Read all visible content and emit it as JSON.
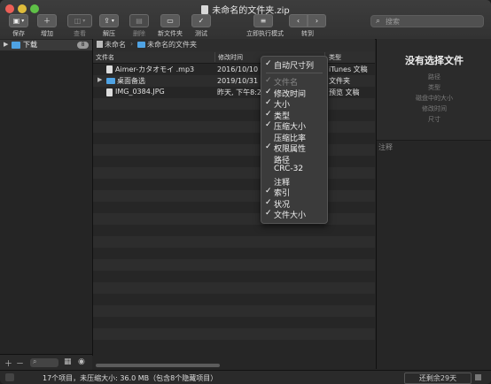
{
  "window": {
    "title": "未命名的文件夹.zip"
  },
  "toolbar": {
    "save": "保存",
    "add": "增加",
    "view": "查看",
    "extract": "解压",
    "delete": "删除",
    "new_folder": "新文件夹",
    "test": "测试",
    "exec_mode": "立即执行模式",
    "goto": "转到",
    "search_placeholder": "搜索"
  },
  "sidebar": {
    "item_label": "下载",
    "item_badge": "8"
  },
  "pathbar": {
    "root": "未命名",
    "folder": "未命名的文件夹"
  },
  "table": {
    "headers": {
      "name": "文件名",
      "modified": "修改时间",
      "type": "类型"
    },
    "rows": [
      {
        "name": "Aimer-カタオモイ .mp3",
        "modified": "2016/10/10 下",
        "type": "iTunes 文稿"
      },
      {
        "name": "桌面备选",
        "modified": "2019/10/31 下",
        "type": "文件夹"
      },
      {
        "name": "IMG_0384.JPG",
        "modified": "昨天, 下午8:2",
        "type": "预览 文稿"
      }
    ]
  },
  "context_menu": {
    "auto_size": "自动尺寸列",
    "items": [
      {
        "label": "文件名",
        "checked": true,
        "disabled": true
      },
      {
        "label": "修改时间",
        "checked": true,
        "disabled": false
      },
      {
        "label": "大小",
        "checked": true,
        "disabled": false
      },
      {
        "label": "类型",
        "checked": true,
        "disabled": false
      },
      {
        "label": "压缩大小",
        "checked": true,
        "disabled": false
      },
      {
        "label": "压缩比率",
        "checked": false,
        "disabled": false
      },
      {
        "label": "权限属性",
        "checked": true,
        "disabled": false
      },
      {
        "label": "路径",
        "checked": false,
        "disabled": false
      },
      {
        "label": "CRC-32",
        "checked": false,
        "disabled": false
      },
      {
        "label": "注释",
        "checked": false,
        "disabled": false
      },
      {
        "label": "索引",
        "checked": true,
        "disabled": false
      },
      {
        "label": "状况",
        "checked": true,
        "disabled": false
      },
      {
        "label": "文件大小",
        "checked": true,
        "disabled": false
      }
    ]
  },
  "info_panel": {
    "title": "没有选择文件",
    "fields": [
      "路径",
      "类型",
      "磁盘中的大小",
      "修改时间",
      "尺寸"
    ],
    "comment_label": "注释"
  },
  "statusbar": {
    "text": "17个项目，未压缩大小: 36.0 MB（包含8个隐藏项目）",
    "trial": "还剩余29天"
  }
}
